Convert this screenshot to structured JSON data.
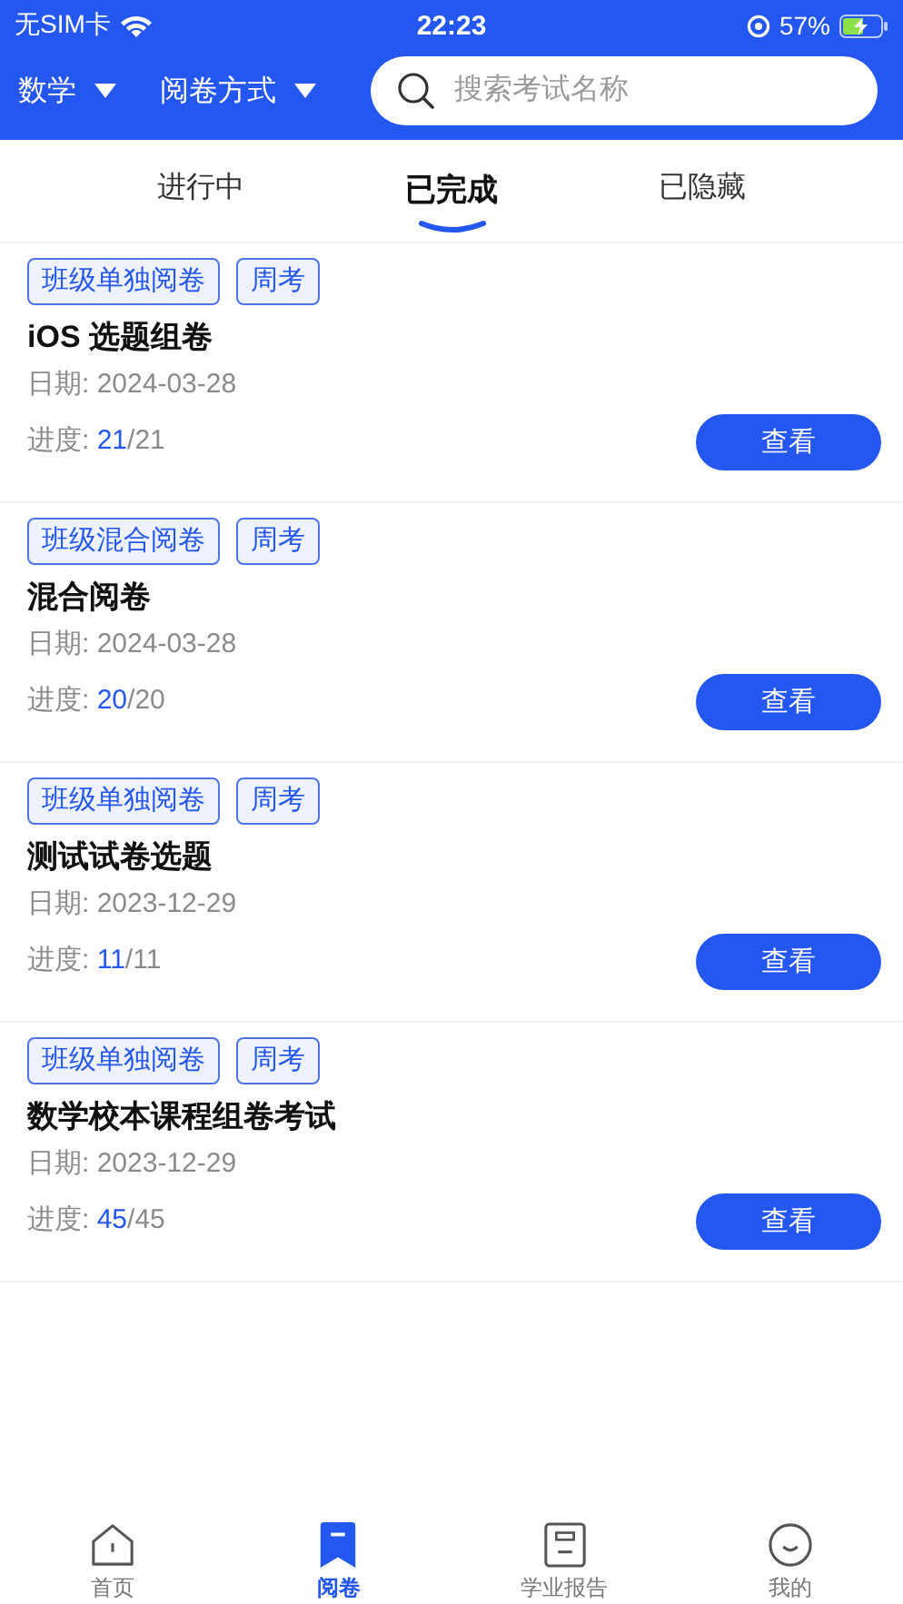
{
  "status_bar": {
    "carrier": "无SIM卡",
    "time": "22:23",
    "battery": "57%"
  },
  "header": {
    "filters": [
      {
        "label": "数学"
      },
      {
        "label": "阅卷方式"
      }
    ],
    "search": {
      "placeholder": "搜索考试名称"
    }
  },
  "tabs": [
    {
      "label": "进行中",
      "selected": false
    },
    {
      "label": "已完成",
      "selected": true
    },
    {
      "label": "已隐藏",
      "selected": false
    }
  ],
  "exams": [
    {
      "tags": [
        "班级单独阅卷",
        "周考"
      ],
      "title": "iOS 选题组卷",
      "date": "日期: 2024-03-28",
      "progress_label": "进度: ",
      "done": "21",
      "total": "/21",
      "button": "查看"
    },
    {
      "tags": [
        "班级混合阅卷",
        "周考"
      ],
      "title": "混合阅卷",
      "date": "日期: 2024-03-28",
      "progress_label": "进度: ",
      "done": "20",
      "total": "/20",
      "button": "查看"
    },
    {
      "tags": [
        "班级单独阅卷",
        "周考"
      ],
      "title": "测试试卷选题",
      "date": "日期: 2023-12-29",
      "progress_label": "进度: ",
      "done": "11",
      "total": "/11",
      "button": "查看"
    },
    {
      "tags": [
        "班级单独阅卷",
        "周考"
      ],
      "title": "数学校本课程组卷考试",
      "date": "日期: 2023-12-29",
      "progress_label": "进度: ",
      "done": "45",
      "total": "/45",
      "button": "查看"
    }
  ],
  "bottom_nav": [
    {
      "label": "首页",
      "kind": "home",
      "selected": false
    },
    {
      "label": "阅卷",
      "kind": "bookmark",
      "selected": true
    },
    {
      "label": "学业报告",
      "kind": "report",
      "selected": false
    },
    {
      "label": "我的",
      "kind": "smile",
      "selected": false
    }
  ]
}
